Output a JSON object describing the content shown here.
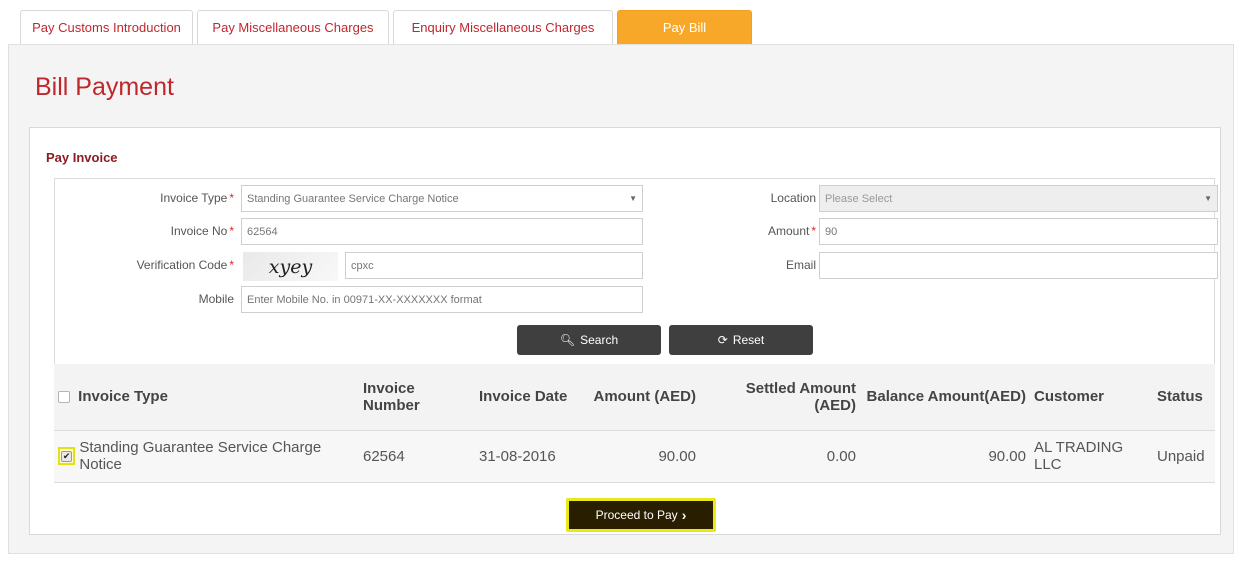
{
  "tabs": [
    {
      "label": "Pay Customs Introduction"
    },
    {
      "label": "Pay Miscellaneous Charges"
    },
    {
      "label": "Enquiry Miscellaneous Charges"
    },
    {
      "label": "Pay Bill",
      "active": true
    }
  ],
  "page": {
    "title": "Bill Payment"
  },
  "panel": {
    "title": "Pay Invoice"
  },
  "form": {
    "invoice_type": {
      "label": "Invoice Type",
      "value": "Standing Guarantee Service Charge Notice"
    },
    "invoice_no": {
      "label": "Invoice No",
      "value": "62564"
    },
    "verification": {
      "label": "Verification Code",
      "captcha_text": "xyey",
      "value": "cpxc"
    },
    "mobile": {
      "label": "Mobile",
      "placeholder": "Enter Mobile No. in 00971-XX-XXXXXXX format"
    },
    "location": {
      "label": "Location",
      "value": "Please Select"
    },
    "amount": {
      "label": "Amount",
      "value": "90"
    },
    "email": {
      "label": "Email",
      "value": ""
    },
    "required_mark": "*"
  },
  "buttons": {
    "search": "Search",
    "reset": "Reset",
    "proceed": "Proceed to Pay"
  },
  "table": {
    "columns": [
      "Invoice Type",
      "Invoice Number",
      "Invoice Date",
      "Amount (AED)",
      "Settled Amount (AED)",
      "Balance Amount(AED)",
      "Customer",
      "Status"
    ],
    "rows": [
      {
        "checked": true,
        "invoice_type": "Standing Guarantee Service Charge Notice",
        "invoice_number": "62564",
        "invoice_date": "31-08-2016",
        "amount": "90.00",
        "settled_amount": "0.00",
        "balance_amount": "90.00",
        "customer": "AL TRADING LLC",
        "status": "Unpaid"
      }
    ]
  },
  "colors": {
    "accent": "#c0272d",
    "active_tab": "#f7a828",
    "highlight": "#e8e81a",
    "dark_button": "#3f3f3f"
  }
}
